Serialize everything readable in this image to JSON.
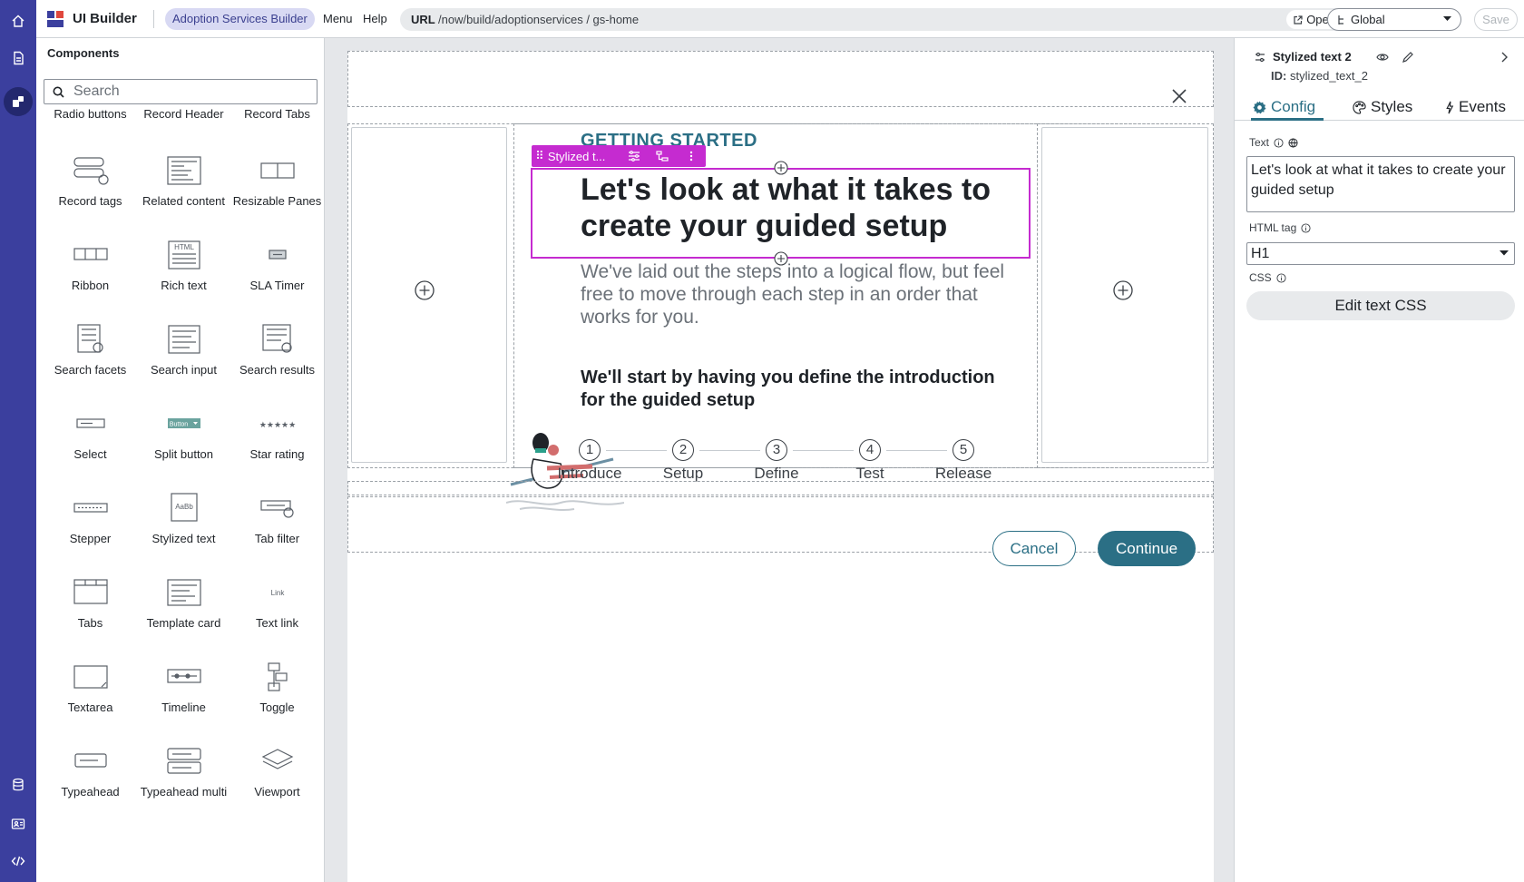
{
  "topbar": {
    "app_title": "UI Builder",
    "experience": "Adoption Services Builder",
    "menu": "Menu",
    "help": "Help",
    "url_label": "URL",
    "url": "/now/build/adoptionservices / gs-home",
    "open": "Open",
    "scope": "Global",
    "save": "Save"
  },
  "components": {
    "title": "Components",
    "search_placeholder": "Search",
    "items": [
      {
        "label": "Radio buttons",
        "icon": "radio-buttons-icon"
      },
      {
        "label": "Record Header",
        "icon": "record-header-icon"
      },
      {
        "label": "Record Tabs",
        "icon": "record-tabs-icon"
      },
      {
        "label": "Record tags",
        "icon": "record-tags-icon"
      },
      {
        "label": "Related content",
        "icon": "related-content-icon"
      },
      {
        "label": "Resizable Panes",
        "icon": "resizable-panes-icon"
      },
      {
        "label": "Ribbon",
        "icon": "ribbon-icon"
      },
      {
        "label": "Rich text",
        "icon": "rich-text-icon"
      },
      {
        "label": "SLA Timer",
        "icon": "sla-timer-icon"
      },
      {
        "label": "Search facets",
        "icon": "search-facets-icon"
      },
      {
        "label": "Search input",
        "icon": "search-input-icon"
      },
      {
        "label": "Search results",
        "icon": "search-results-icon"
      },
      {
        "label": "Select",
        "icon": "select-icon"
      },
      {
        "label": "Split button",
        "icon": "split-button-icon"
      },
      {
        "label": "Star rating",
        "icon": "star-rating-icon"
      },
      {
        "label": "Stepper",
        "icon": "stepper-icon"
      },
      {
        "label": "Stylized text",
        "icon": "stylized-text-icon"
      },
      {
        "label": "Tab filter",
        "icon": "tab-filter-icon"
      },
      {
        "label": "Tabs",
        "icon": "tabs-icon"
      },
      {
        "label": "Template card",
        "icon": "template-card-icon"
      },
      {
        "label": "Text link",
        "icon": "text-link-icon"
      },
      {
        "label": "Textarea",
        "icon": "textarea-icon"
      },
      {
        "label": "Timeline",
        "icon": "timeline-icon"
      },
      {
        "label": "Toggle",
        "icon": "toggle-icon"
      },
      {
        "label": "Typeahead",
        "icon": "typeahead-icon"
      },
      {
        "label": "Typeahead multi",
        "icon": "typeahead-multi-icon"
      },
      {
        "label": "Viewport",
        "icon": "viewport-icon"
      }
    ],
    "icon_texts": {
      "rich_text": "HTML",
      "split_button": "Button",
      "stylized_text": "AaBb",
      "text_link": "Link"
    }
  },
  "canvas": {
    "getting_started": "GETTING STARTED",
    "toolbar_label": "Stylized t...",
    "headline": "Let's look at what it takes to create your guided setup",
    "subtext": "We've laid out the steps into a logical flow, but feel free to move through each step in an order that works for you.",
    "intro": "We'll start by having you define the introduction for the guided setup",
    "steps": [
      {
        "num": "1",
        "label": "Introduce"
      },
      {
        "num": "2",
        "label": "Setup"
      },
      {
        "num": "3",
        "label": "Define"
      },
      {
        "num": "4",
        "label": "Test"
      },
      {
        "num": "5",
        "label": "Release"
      }
    ],
    "cancel": "Cancel",
    "continue": "Continue"
  },
  "props": {
    "component_name": "Stylized text 2",
    "id_label": "ID:",
    "id_value": "stylized_text_2",
    "tabs": [
      "Config",
      "Styles",
      "Events"
    ],
    "text_label": "Text",
    "text_value": "Let's look at what it takes to create your guided setup",
    "html_tag_label": "HTML tag",
    "html_tag_value": "H1",
    "css_label": "CSS",
    "edit_css": "Edit text CSS"
  },
  "colors": {
    "rail": "#3b3f9e",
    "accent": "#2b6f85",
    "selection": "#c52bd0",
    "pill_bg": "#d8d9f3"
  }
}
